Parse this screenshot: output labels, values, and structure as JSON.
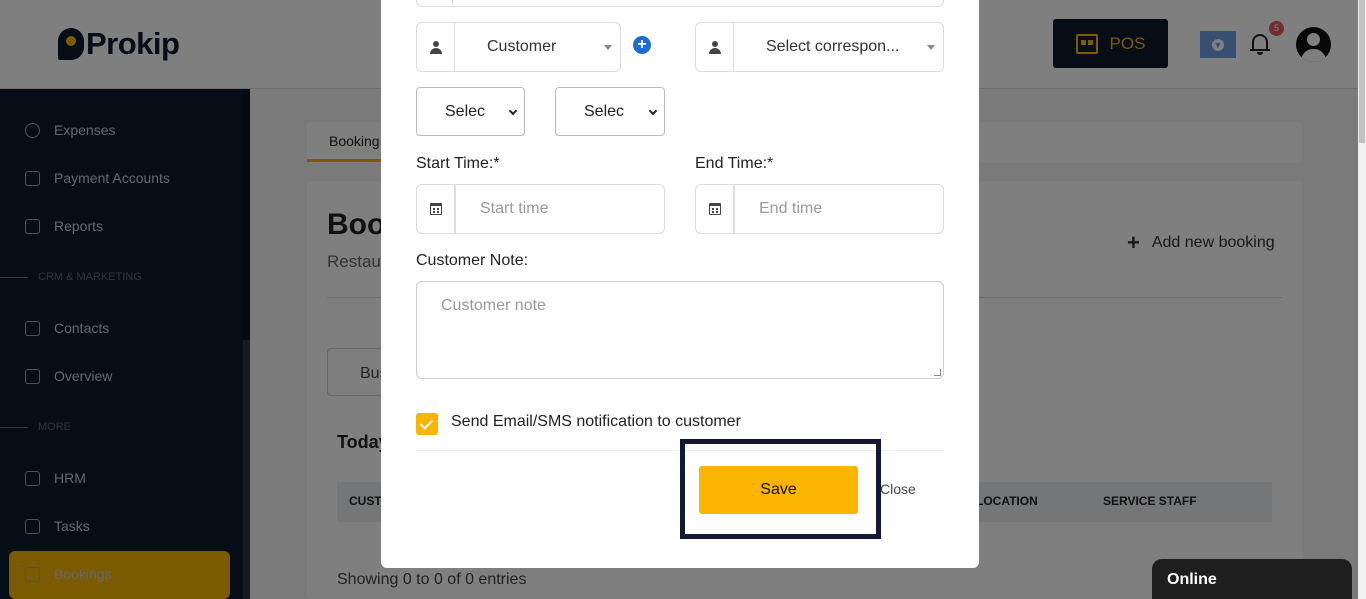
{
  "header": {
    "logo": "Prokip",
    "pos_label": "POS",
    "notification_count": "5"
  },
  "sidebar": {
    "items": [
      {
        "label": "Expenses"
      },
      {
        "label": "Payment Accounts"
      },
      {
        "label": "Reports"
      },
      {
        "label": "Contacts"
      },
      {
        "label": "Overview"
      },
      {
        "label": "HRM"
      },
      {
        "label": "Tasks"
      },
      {
        "label": "Bookings"
      }
    ],
    "sections": {
      "crm": "CRM & MARKETING",
      "more": "MORE"
    }
  },
  "page": {
    "tab": "Booking",
    "title": "Boo",
    "subtitle": "Restau",
    "add_booking": "Add new booking",
    "bus_button": "Bus",
    "today": "Today",
    "table_headers": [
      "CUSTO",
      "LOCATION",
      "SERVICE STAFF"
    ],
    "showing": "Showing 0 to 0 of 0 entries"
  },
  "modal": {
    "customer_select": "Customer",
    "correspondent_select": "Select correspon...",
    "select_1": "Selec",
    "select_2": "Selec",
    "start_time_label": "Start Time:*",
    "start_time_placeholder": "Start time",
    "end_time_label": "End Time:*",
    "end_time_placeholder": "End time",
    "note_label": "Customer Note:",
    "note_placeholder": "Customer note",
    "notify_label": "Send Email/SMS notification to customer",
    "notify_checked": true,
    "save_label": "Save",
    "close_label": "Close"
  },
  "chat": {
    "status": "Online"
  },
  "colors": {
    "brand_dark": "#0f1a2e",
    "accent": "#f7b500",
    "highlight_border": "#141833"
  }
}
